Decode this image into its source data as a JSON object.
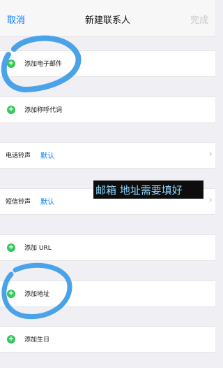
{
  "nav": {
    "cancel": "取消",
    "title": "新建联系人",
    "done": "完成"
  },
  "rows": {
    "add_email": "添加电子邮件",
    "add_pronoun": "添加称呼代词",
    "ringtone": {
      "label": "电话铃声",
      "value": "默认"
    },
    "text_tone": {
      "label": "短信铃声",
      "value": "默认"
    },
    "add_url": "添加 URL",
    "add_address": "添加地址",
    "add_birthday": "添加生日"
  },
  "annotation": {
    "text": "邮箱 地址需要填好",
    "color": "#8fd8ff"
  },
  "colors": {
    "accent": "#007aff",
    "plus": "#34c759",
    "marker": "#4aa3e8"
  }
}
